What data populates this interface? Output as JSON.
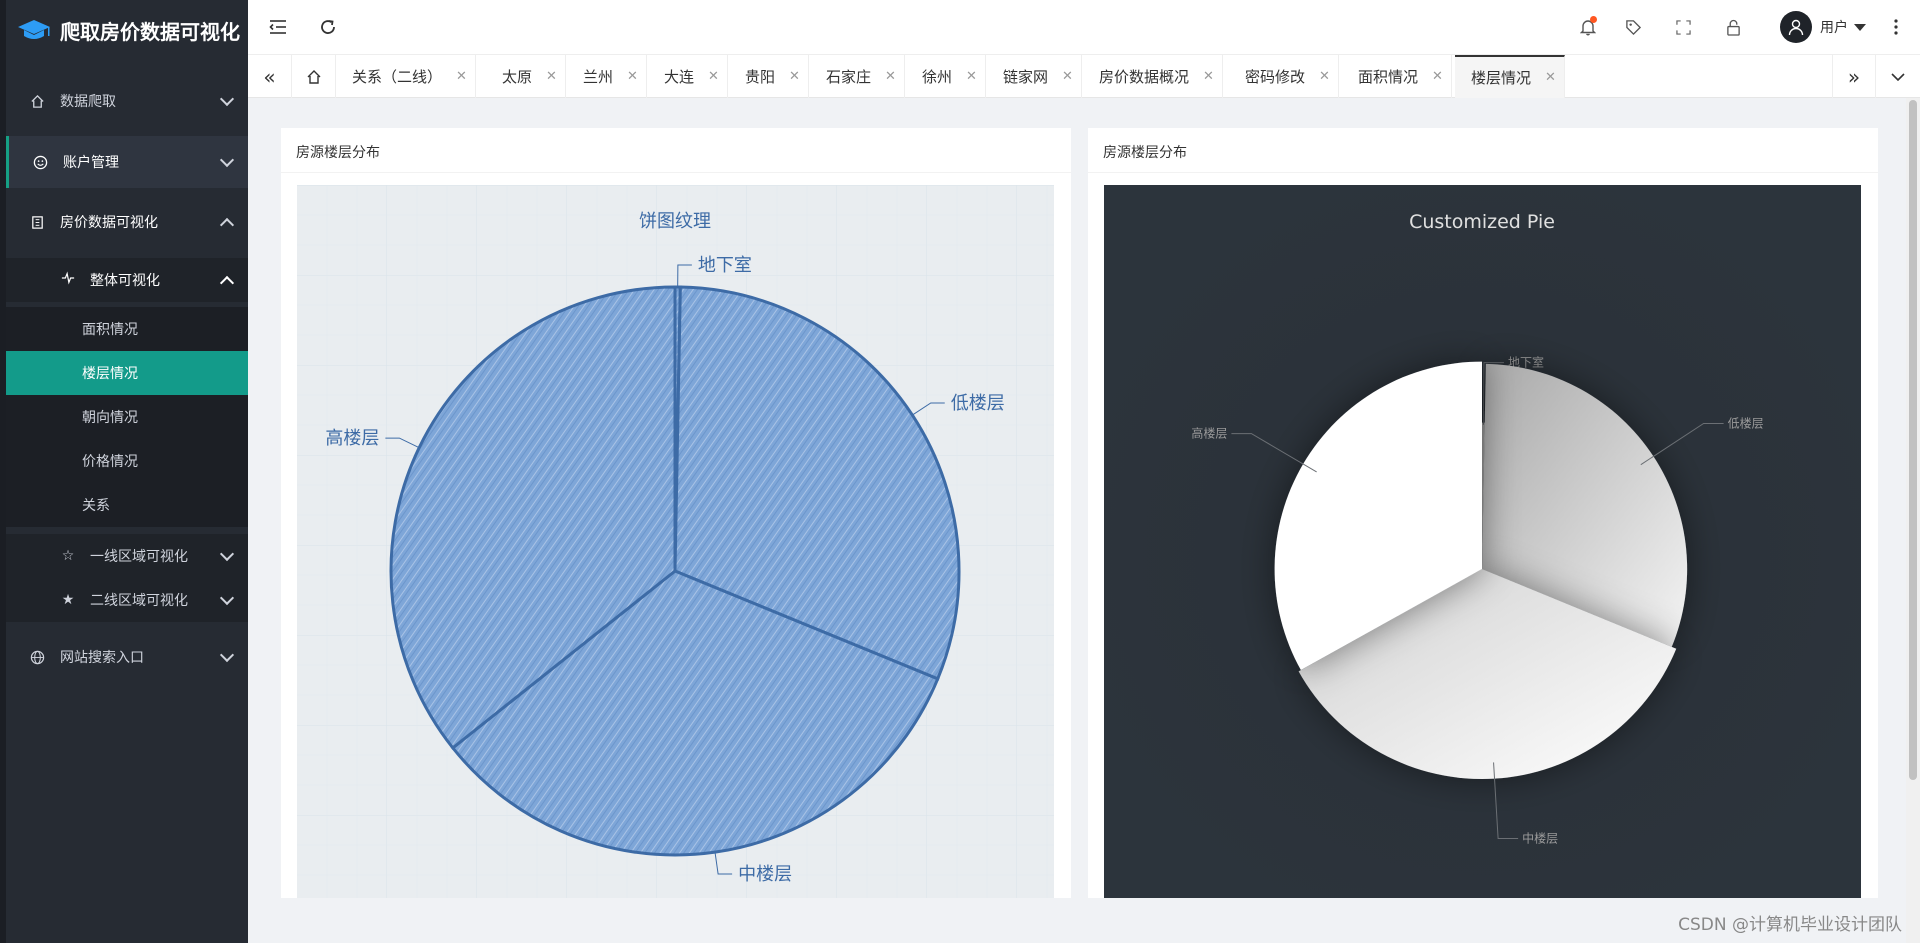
{
  "app": {
    "title": "爬取房价数据可视化"
  },
  "sidebar": {
    "items": [
      {
        "label": "数据爬取"
      },
      {
        "label": "账户管理"
      },
      {
        "label": "房价数据可视化"
      }
    ],
    "overall_group": {
      "label": "整体可视化"
    },
    "sub_items": [
      {
        "label": "面积情况"
      },
      {
        "label": "楼层情况"
      },
      {
        "label": "朝向情况"
      },
      {
        "label": "价格情况"
      },
      {
        "label": "关系"
      }
    ],
    "tier1_group": {
      "label": "一线区域可视化"
    },
    "tier2_group": {
      "label": "二线区域可视化"
    },
    "search_entry": {
      "label": "网站搜索入口"
    }
  },
  "header": {
    "user_label": "用户"
  },
  "tabs": [
    {
      "label": "关系（二线）"
    },
    {
      "label": "太原"
    },
    {
      "label": "兰州"
    },
    {
      "label": "大连"
    },
    {
      "label": "贵阳"
    },
    {
      "label": "石家庄"
    },
    {
      "label": "徐州"
    },
    {
      "label": "链家网"
    },
    {
      "label": "房价数据概况"
    },
    {
      "label": "密码修改"
    },
    {
      "label": "面积情况"
    },
    {
      "label": "楼层情况"
    }
  ],
  "cards": [
    {
      "title": "房源楼层分布"
    },
    {
      "title": "房源楼层分布"
    }
  ],
  "watermark": "CSDN @计算机毕业设计团队",
  "chart_data": [
    {
      "type": "pie",
      "title": "饼图纹理",
      "categories": [
        "地下室",
        "低楼层",
        "中楼层",
        "高楼层"
      ],
      "values": [
        0.3,
        30.9,
        33.1,
        35.7
      ],
      "colors": {
        "fill": "#7ea6d8",
        "stroke": "#3d6ba6",
        "text": "#3d6ba6",
        "background": "#e9edf0"
      }
    },
    {
      "type": "pie",
      "title": "Customized Pie",
      "categories": [
        "地下室",
        "低楼层",
        "中楼层",
        "高楼层"
      ],
      "values": [
        0.3,
        30.9,
        35.7,
        33.1
      ],
      "colors": {
        "background": "#2c343c",
        "label": "#9a9a9a"
      }
    }
  ]
}
